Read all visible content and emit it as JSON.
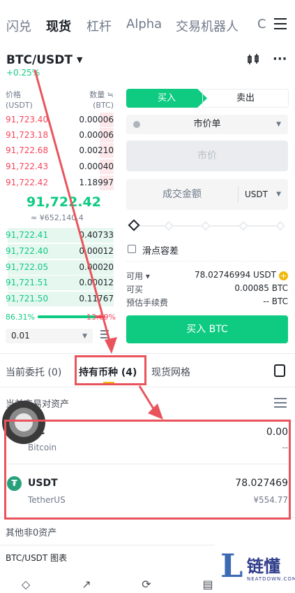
{
  "nav": {
    "items": [
      "闪兑",
      "现货",
      "杠杆",
      "Alpha",
      "交易机器人",
      "C"
    ],
    "active": "现货"
  },
  "pair": {
    "symbol": "BTC/USDT",
    "change": "+0.25%"
  },
  "orderbook": {
    "price_header": "价格",
    "price_unit": "(USDT)",
    "qty_header": "数量 ≒",
    "qty_unit": "(BTC)",
    "asks": [
      {
        "price": "91,723.40",
        "qty": "0.00006",
        "depth": 0.12
      },
      {
        "price": "91,723.18",
        "qty": "0.00006",
        "depth": 0.12
      },
      {
        "price": "91,722.68",
        "qty": "0.00210",
        "depth": 0.12
      },
      {
        "price": "91,722.43",
        "qty": "0.00040",
        "depth": 0.12
      },
      {
        "price": "91,722.42",
        "qty": "1.18997",
        "depth": 0.12
      }
    ],
    "last_price": "91,722.42",
    "fiat_price": "≈ ¥652,140.4",
    "bids": [
      {
        "price": "91,722.41",
        "qty": "0.40733",
        "depth": 0.93
      },
      {
        "price": "91,722.40",
        "qty": "0.00012",
        "depth": 0.93
      },
      {
        "price": "91,722.05",
        "qty": "0.00020",
        "depth": 0.93
      },
      {
        "price": "91,721.51",
        "qty": "0.00012",
        "depth": 0.93
      },
      {
        "price": "91,721.50",
        "qty": "0.11767",
        "depth": 0.93
      }
    ],
    "buy_ratio": "86.31%",
    "sell_ratio": "13.69%",
    "buy_ratio_value": 0.8631,
    "precision": "0.01"
  },
  "order_form": {
    "buy_tab": "买入",
    "sell_tab": "卖出",
    "order_type": "市价单",
    "price_placeholder": "市价",
    "amount_label": "成交金额",
    "amount_unit": "USDT",
    "slippage_label": "滑点容差",
    "available_label": "可用 ▾",
    "available_value": "78.02746994 USDT",
    "can_buy_label": "可买",
    "can_buy_value": "0.00085 BTC",
    "fee_label": "预估手续费",
    "fee_value": "-- BTC",
    "buy_button": "买入 BTC"
  },
  "bottom_tabs": {
    "open_orders": "当前委托 (0)",
    "holdings": "持有币种 (4)",
    "grid": "现货网格"
  },
  "holdings": {
    "section_title": "当前交易对资产",
    "assets": [
      {
        "symbol": "C",
        "name": "Bitcoin",
        "amount": "0.00",
        "fiat": "--"
      },
      {
        "symbol": "USDT",
        "name": "TetherUS",
        "amount": "78.027469",
        "fiat": "¥554.77"
      }
    ],
    "other_title": "其他非0资产",
    "chart_link": "BTC/USDT 图表"
  },
  "watermark": {
    "brand": "链懂",
    "url": "NEATDOWN.COM"
  },
  "colors": {
    "green": "#0ecb81",
    "red": "#f6465d",
    "yellow": "#f0b90b",
    "annotation": "#e9545c"
  }
}
